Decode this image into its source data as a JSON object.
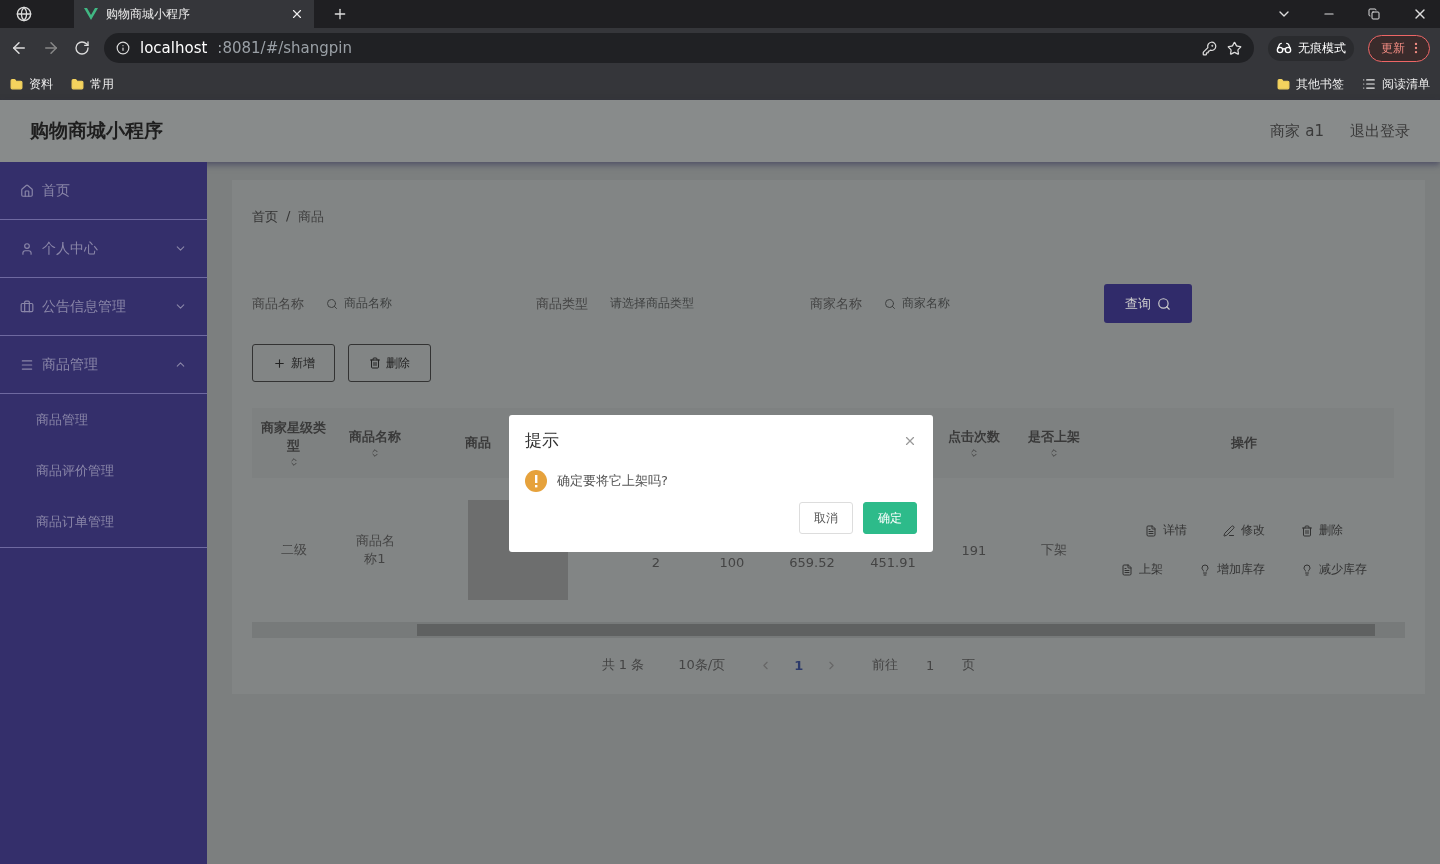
{
  "browser": {
    "tab_title": "购物商城小程序",
    "address_host": "localhost",
    "address_path": ":8081/#/shangpin",
    "profile_label": "无痕模式",
    "update_button": "更新",
    "bookmarks": [
      {
        "label": "资料",
        "kind": "folder"
      },
      {
        "label": "常用",
        "kind": "folder"
      }
    ],
    "bookmarks_right": [
      {
        "label": "其他书签",
        "kind": "folder"
      },
      {
        "label": "阅读清单",
        "kind": "list"
      }
    ]
  },
  "header": {
    "title": "购物商城小程序",
    "user": "商家 a1",
    "logout": "退出登录"
  },
  "sidebar": {
    "items": [
      {
        "label": "首页",
        "kind": "home"
      },
      {
        "label": "个人中心",
        "kind": "user",
        "expanded": false
      },
      {
        "label": "公告信息管理",
        "kind": "notice",
        "expanded": false
      },
      {
        "label": "商品管理",
        "kind": "goods",
        "expanded": true,
        "children": [
          {
            "label": "商品管理"
          },
          {
            "label": "商品评价管理"
          },
          {
            "label": "商品订单管理"
          }
        ]
      }
    ]
  },
  "breadcrumb": [
    "首页",
    "/",
    "商品"
  ],
  "search": {
    "fields": [
      {
        "label": "商品名称",
        "placeholder": "商品名称",
        "kind": "input"
      },
      {
        "label": "商品类型",
        "placeholder": "请选择商品类型",
        "kind": "select"
      },
      {
        "label": "商家名称",
        "placeholder": "商家名称",
        "kind": "input"
      }
    ],
    "button": "查询"
  },
  "actions": [
    {
      "label": "新增",
      "kind": "add"
    },
    {
      "label": "删除",
      "kind": "delete"
    }
  ],
  "table": {
    "columns": [
      {
        "label": "商家星级类型",
        "sortable": true
      },
      {
        "label": "商品名称",
        "sortable": true
      },
      {
        "label": "商品",
        "kind": "covered"
      },
      {
        "kind": "covered"
      },
      {
        "kind": "covered"
      },
      {
        "kind": "covered"
      },
      {
        "kind": "covered"
      },
      {
        "label": "点击次数",
        "sortable": true
      },
      {
        "label": "是否上架",
        "sortable": true
      },
      {
        "label": "操作"
      }
    ],
    "rows": [
      {
        "cells": [
          "二级",
          "商品名称1",
          "",
          "2",
          "100",
          "659.52",
          "451.91",
          "191",
          "下架"
        ],
        "operations": [
          {
            "label": "详情",
            "kind": "detail"
          },
          {
            "label": "修改",
            "kind": "edit"
          },
          {
            "label": "删除",
            "kind": "delete"
          },
          {
            "label": "上架",
            "kind": "shelf"
          },
          {
            "label": "增加库存",
            "kind": "stock"
          },
          {
            "label": "减少库存",
            "kind": "stock"
          }
        ]
      }
    ]
  },
  "pagination": {
    "total": "共 1 条",
    "page_size": "10条/页",
    "pages": [
      {
        "label": "1",
        "selected": true
      }
    ],
    "goto_label": "前往",
    "goto_value": "1",
    "goto_suffix": "页"
  },
  "dialog": {
    "title": "提示",
    "message": "确定要将它上架吗?",
    "buttons": [
      {
        "label": "取消",
        "kind": "secondary"
      },
      {
        "label": "确定",
        "kind": "primary"
      }
    ]
  }
}
